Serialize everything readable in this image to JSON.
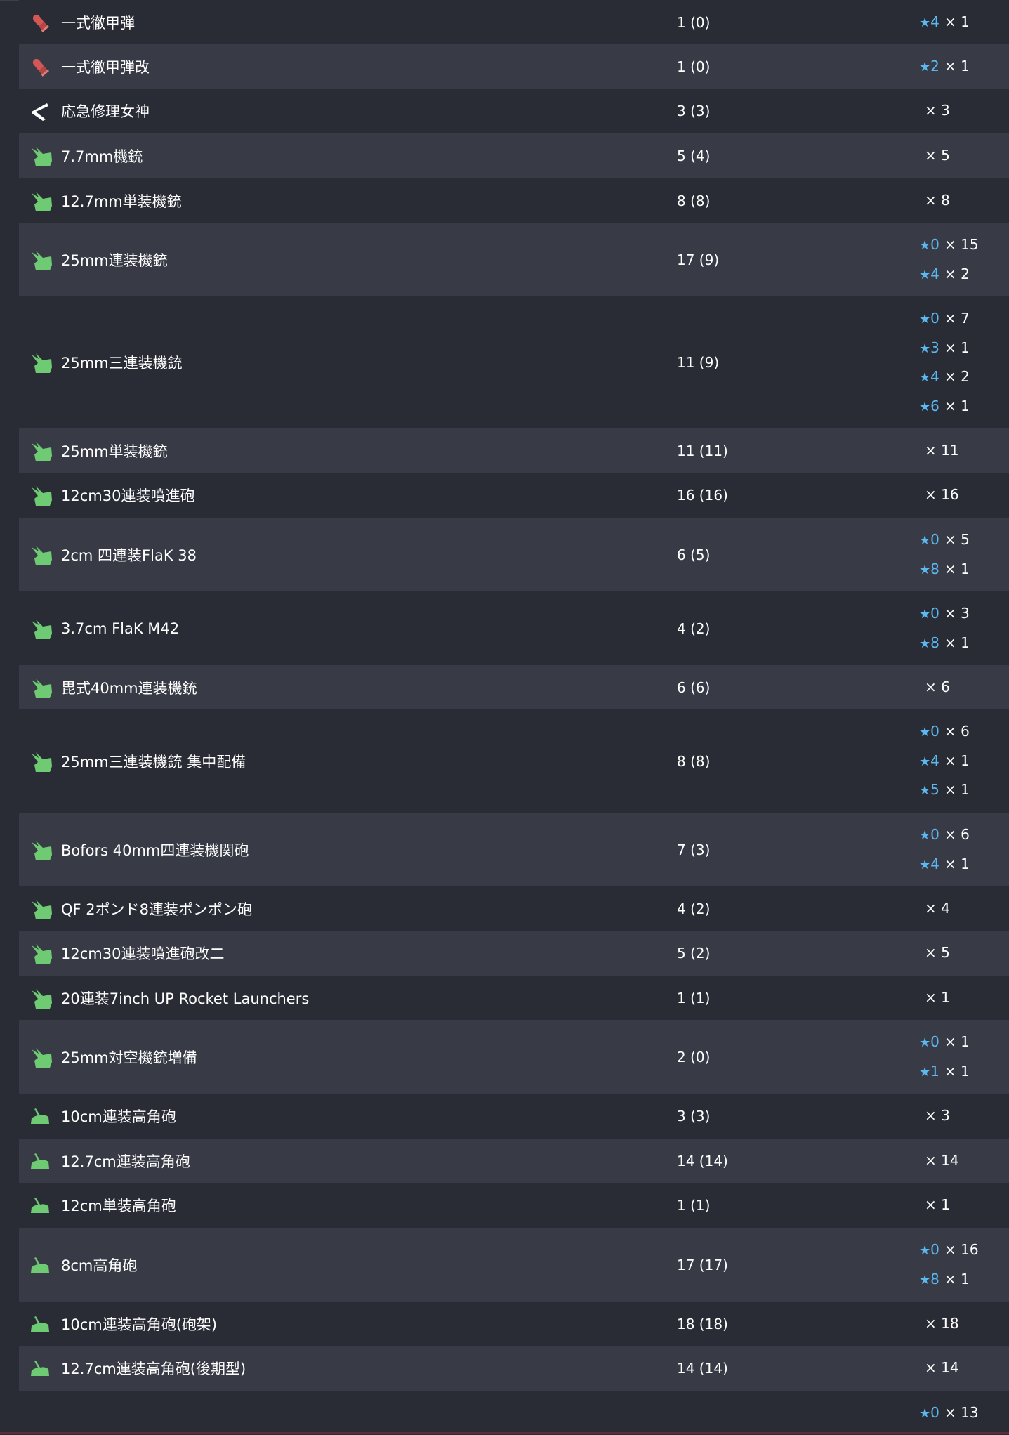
{
  "rows": [
    {
      "icon": "ap-shell-icon",
      "name": "一式徹甲弾",
      "count": "1 (0)",
      "improvements": [
        {
          "level": "4",
          "qty": "× 1"
        }
      ]
    },
    {
      "icon": "ap-shell-icon",
      "name": "一式徹甲弾改",
      "count": "1 (0)",
      "improvements": [
        {
          "level": "2",
          "qty": "× 1"
        }
      ]
    },
    {
      "icon": "repair-tool-icon",
      "name": "応急修理女神",
      "count": "3 (3)",
      "improvements": [
        {
          "level": "",
          "qty": "× 3"
        }
      ]
    },
    {
      "icon": "aa-gun-icon",
      "name": "7.7mm機銃",
      "count": "5 (4)",
      "improvements": [
        {
          "level": "",
          "qty": "× 5"
        }
      ]
    },
    {
      "icon": "aa-gun-icon",
      "name": "12.7mm単装機銃",
      "count": "8 (8)",
      "improvements": [
        {
          "level": "",
          "qty": "× 8"
        }
      ]
    },
    {
      "icon": "aa-gun-icon",
      "name": "25mm連装機銃",
      "count": "17 (9)",
      "improvements": [
        {
          "level": "0",
          "qty": "× 15"
        },
        {
          "level": "4",
          "qty": "× 2"
        }
      ]
    },
    {
      "icon": "aa-gun-icon",
      "name": "25mm三連装機銃",
      "count": "11 (9)",
      "improvements": [
        {
          "level": "0",
          "qty": "× 7"
        },
        {
          "level": "3",
          "qty": "× 1"
        },
        {
          "level": "4",
          "qty": "× 2"
        },
        {
          "level": "6",
          "qty": "× 1"
        }
      ]
    },
    {
      "icon": "aa-gun-icon",
      "name": "25mm単装機銃",
      "count": "11 (11)",
      "improvements": [
        {
          "level": "",
          "qty": "× 11"
        }
      ]
    },
    {
      "icon": "aa-gun-icon",
      "name": "12cm30連装噴進砲",
      "count": "16 (16)",
      "improvements": [
        {
          "level": "",
          "qty": "× 16"
        }
      ]
    },
    {
      "icon": "aa-gun-icon",
      "name": "2cm 四連装FlaK 38",
      "count": "6 (5)",
      "improvements": [
        {
          "level": "0",
          "qty": "× 5"
        },
        {
          "level": "8",
          "qty": "× 1"
        }
      ]
    },
    {
      "icon": "aa-gun-icon",
      "name": "3.7cm FlaK M42",
      "count": "4 (2)",
      "improvements": [
        {
          "level": "0",
          "qty": "× 3"
        },
        {
          "level": "8",
          "qty": "× 1"
        }
      ]
    },
    {
      "icon": "aa-gun-icon",
      "name": "毘式40mm連装機銃",
      "count": "6 (6)",
      "improvements": [
        {
          "level": "",
          "qty": "× 6"
        }
      ]
    },
    {
      "icon": "aa-gun-icon",
      "name": "25mm三連装機銃 集中配備",
      "count": "8 (8)",
      "improvements": [
        {
          "level": "0",
          "qty": "× 6"
        },
        {
          "level": "4",
          "qty": "× 1"
        },
        {
          "level": "5",
          "qty": "× 1"
        }
      ]
    },
    {
      "icon": "aa-gun-icon",
      "name": "Bofors 40mm四連装機関砲",
      "count": "7 (3)",
      "improvements": [
        {
          "level": "0",
          "qty": "× 6"
        },
        {
          "level": "4",
          "qty": "× 1"
        }
      ]
    },
    {
      "icon": "aa-gun-icon",
      "name": "QF 2ポンド8連装ポンポン砲",
      "count": "4 (2)",
      "improvements": [
        {
          "level": "",
          "qty": "× 4"
        }
      ]
    },
    {
      "icon": "aa-gun-icon",
      "name": "12cm30連装噴進砲改二",
      "count": "5 (2)",
      "improvements": [
        {
          "level": "",
          "qty": "× 5"
        }
      ]
    },
    {
      "icon": "aa-gun-icon",
      "name": "20連装7inch UP Rocket Launchers",
      "count": "1 (1)",
      "improvements": [
        {
          "level": "",
          "qty": "× 1"
        }
      ]
    },
    {
      "icon": "aa-gun-icon",
      "name": "25mm対空機銃増備",
      "count": "2 (0)",
      "improvements": [
        {
          "level": "0",
          "qty": "× 1"
        },
        {
          "level": "1",
          "qty": "× 1"
        }
      ]
    },
    {
      "icon": "ha-gun-icon",
      "name": "10cm連装高角砲",
      "count": "3 (3)",
      "improvements": [
        {
          "level": "",
          "qty": "× 3"
        }
      ]
    },
    {
      "icon": "ha-gun-icon",
      "name": "12.7cm連装高角砲",
      "count": "14 (14)",
      "improvements": [
        {
          "level": "",
          "qty": "× 14"
        }
      ]
    },
    {
      "icon": "ha-gun-icon",
      "name": "12cm単装高角砲",
      "count": "1 (1)",
      "improvements": [
        {
          "level": "",
          "qty": "× 1"
        }
      ]
    },
    {
      "icon": "ha-gun-icon",
      "name": "8cm高角砲",
      "count": "17 (17)",
      "improvements": [
        {
          "level": "0",
          "qty": "× 16"
        },
        {
          "level": "8",
          "qty": "× 1"
        }
      ]
    },
    {
      "icon": "ha-gun-icon",
      "name": "10cm連装高角砲(砲架)",
      "count": "18 (18)",
      "improvements": [
        {
          "level": "",
          "qty": "× 18"
        }
      ]
    },
    {
      "icon": "ha-gun-icon",
      "name": "12.7cm連装高角砲(後期型)",
      "count": "14 (14)",
      "improvements": [
        {
          "level": "",
          "qty": "× 14"
        }
      ]
    },
    {
      "icon": "",
      "name": "",
      "count": "",
      "improvements": [
        {
          "level": "0",
          "qty": "× 13"
        }
      ]
    }
  ],
  "colors": {
    "background": "#292c35",
    "row_alt": "#383b45",
    "star": "#5bb8f0",
    "aa_icon": "#6fcb73",
    "ap_icon": "#d25a5a"
  }
}
